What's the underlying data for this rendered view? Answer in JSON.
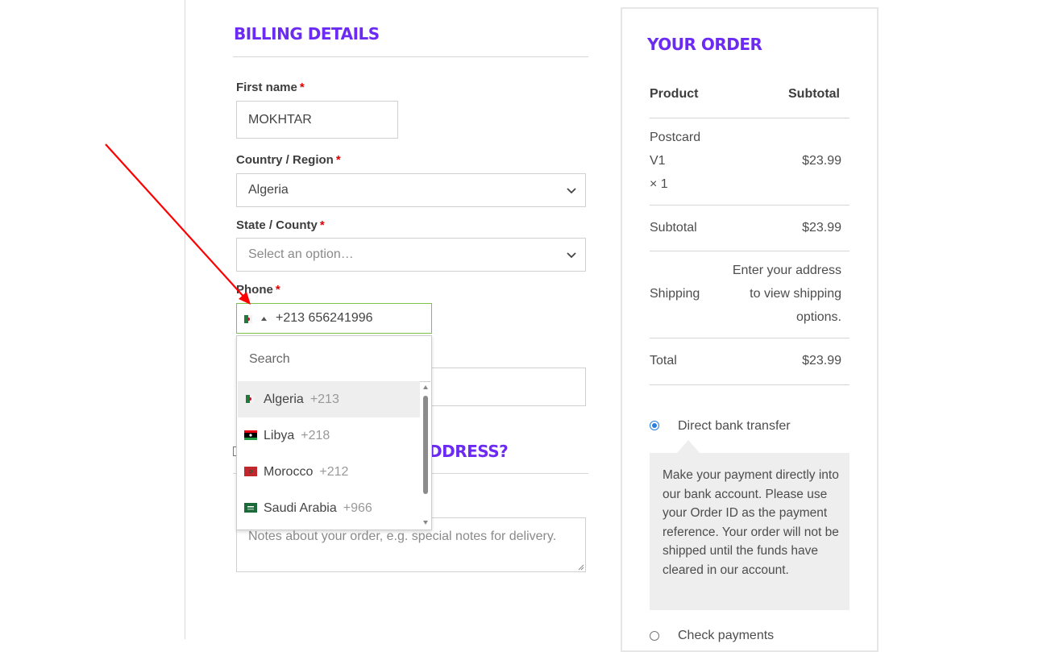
{
  "billing": {
    "title": "BILLING DETAILS",
    "first_name": {
      "label": "First name",
      "required_mark": "*",
      "value": "MOKHTAR"
    },
    "country": {
      "label": "Country / Region",
      "required_mark": "*",
      "value": "Algeria"
    },
    "state": {
      "label": "State / County",
      "required_mark": "*",
      "placeholder": "Select an option…"
    },
    "phone": {
      "label": "Phone",
      "required_mark": "*",
      "value": "+213 656241996",
      "flag_icon": "algeria-flag-icon"
    },
    "ship_heading_visible": "DDRESS?",
    "notes_placeholder": "Notes about your order, e.g. special notes for delivery."
  },
  "phone_dropdown": {
    "search_placeholder": "Search",
    "items": [
      {
        "name": "Algeria",
        "code": "+213",
        "flag_icon": "algeria-flag-icon",
        "selected": true
      },
      {
        "name": "Libya",
        "code": "+218",
        "flag_icon": "libya-flag-icon",
        "selected": false
      },
      {
        "name": "Morocco",
        "code": "+212",
        "flag_icon": "morocco-flag-icon",
        "selected": false
      },
      {
        "name": "Saudi Arabia",
        "code": "+966",
        "flag_icon": "saudi-arabia-flag-icon",
        "selected": false
      }
    ]
  },
  "order": {
    "title": "YOUR ORDER",
    "col_product": "Product",
    "col_subtotal": "Subtotal",
    "item_lines": [
      "Postcard",
      "V1",
      "× 1"
    ],
    "item_price": "$23.99",
    "subtotal_label": "Subtotal",
    "subtotal_value": "$23.99",
    "shipping_label": "Shipping",
    "shipping_lines": [
      "Enter your address",
      "to view shipping",
      "options."
    ],
    "total_label": "Total",
    "total_value": "$23.99",
    "payment_option_1": "Direct bank transfer",
    "payment_desc": "Make your payment directly into our bank account. Please use your Order ID as the payment reference. Your order will not be shipped until the funds have cleared in our account.",
    "payment_option_2": "Check payments"
  },
  "colors": {
    "heading": "#6c2bf2",
    "required": "#e00000",
    "phone_focus": "#7cc14a",
    "radio_on": "#2a7de1",
    "annotation_arrow": "#ff0000"
  }
}
